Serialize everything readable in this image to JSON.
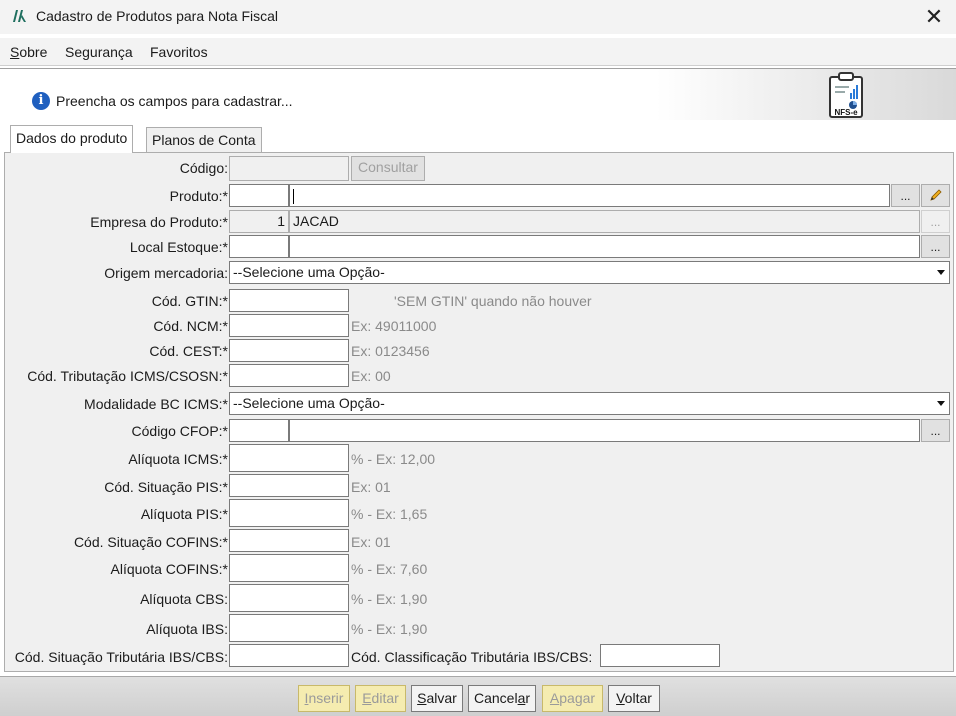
{
  "window": {
    "title": "Cadastro de Produtos para Nota Fiscal"
  },
  "menu": {
    "sobre_first": "S",
    "sobre_rest": "obre",
    "seguranca": "Segurança",
    "favoritos": "Favoritos"
  },
  "banner": {
    "message": "Preencha os campos para cadastrar...",
    "icon_label": "NFS-e"
  },
  "tabs": [
    "Dados do produto",
    "Planos de Conta"
  ],
  "form": {
    "codigo": {
      "label": "Código:",
      "button": "Consultar"
    },
    "produto": {
      "label": "Produto:*",
      "dots": "..."
    },
    "empresa": {
      "label": "Empresa do Produto:*",
      "code": "1",
      "name": "JACAD",
      "dots": "..."
    },
    "local": {
      "label": "Local Estoque:*",
      "dots": "..."
    },
    "origem": {
      "label": "Origem mercadoria:",
      "selected": "--Selecione uma Opção-"
    },
    "gtin": {
      "label": "Cód. GTIN:*",
      "hint": "'SEM GTIN' quando não houver"
    },
    "ncm": {
      "label": "Cód. NCM:*",
      "hint": "Ex: 49011000"
    },
    "cest": {
      "label": "Cód. CEST:*",
      "hint": "Ex: 0123456"
    },
    "icms_csosn": {
      "label": "Cód. Tributação ICMS/CSOSN:*",
      "hint": "Ex: 00"
    },
    "modalidade": {
      "label": "Modalidade BC ICMS:*",
      "selected": "--Selecione uma Opção-"
    },
    "cfop": {
      "label": "Código CFOP:*",
      "dots": "..."
    },
    "aliq_icms": {
      "label": "Alíquota ICMS:*",
      "hint": "% - Ex: 12,00"
    },
    "sit_pis": {
      "label": "Cód. Situação PIS:*",
      "hint": "Ex: 01"
    },
    "aliq_pis": {
      "label": "Alíquota PIS:*",
      "hint": "% - Ex: 1,65"
    },
    "sit_cofins": {
      "label": "Cód. Situação COFINS:*",
      "hint": "Ex: 01"
    },
    "aliq_cofins": {
      "label": "Alíquota COFINS:*",
      "hint": "% - Ex: 7,60"
    },
    "aliq_cbs": {
      "label": "Alíquota CBS:",
      "hint": "% - Ex: 1,90"
    },
    "aliq_ibs": {
      "label": "Alíquota IBS:",
      "hint": "% - Ex: 1,90"
    },
    "sit_ibs_cbs": {
      "label": "Cód. Situação Tributária IBS/CBS:"
    },
    "class_ibs_cbs": {
      "label": "Cód. Classificação Tributária IBS/CBS:"
    }
  },
  "footer": {
    "inserir": {
      "u": "I",
      "rest": "nserir"
    },
    "editar": {
      "u": "E",
      "rest": "ditar"
    },
    "salvar": {
      "u": "S",
      "rest": "alvar"
    },
    "cancelar": {
      "pre": "Cancel",
      "u": "a",
      "rest": "r"
    },
    "apagar": {
      "u": "A",
      "rest": "pagar"
    },
    "voltar": {
      "u": "V",
      "rest": "oltar"
    }
  }
}
